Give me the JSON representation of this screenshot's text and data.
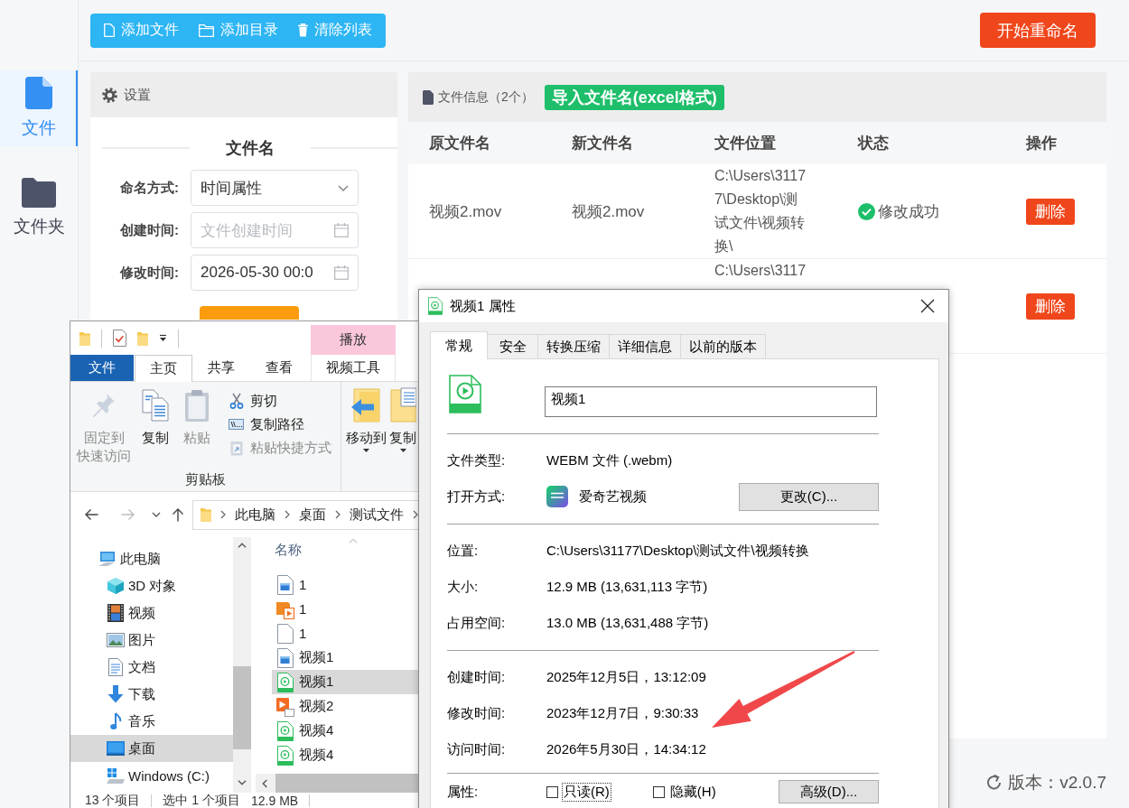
{
  "sidebar": {
    "items": [
      {
        "label": "文件",
        "selected": true
      },
      {
        "label": "文件夹",
        "selected": false
      }
    ]
  },
  "toolbar": {
    "buttons": [
      "添加文件",
      "添加目录",
      "清除列表"
    ],
    "start_button": "开始重命名"
  },
  "settings": {
    "title": "设置",
    "section": "文件名",
    "fields": [
      {
        "label": "命名方式:",
        "kind": "select",
        "value": "时间属性"
      },
      {
        "label": "创建时间:",
        "kind": "date",
        "placeholder": "文件创建时间"
      },
      {
        "label": "修改时间:",
        "kind": "date",
        "value": "2026-05-30 00:0"
      }
    ]
  },
  "file_panel": {
    "title": "文件信息（2个）",
    "import_button": "导入文件名(excel格式)",
    "columns": [
      "原文件名",
      "新文件名",
      "文件位置",
      "状态",
      "操作"
    ],
    "rows": [
      {
        "original": "视频2.mov",
        "new_name": "视频2.mov",
        "location": "C:\\Users\\31177\\Desktop\\测试文件\\视频转换\\",
        "status": "修改成功",
        "success": true,
        "action": "删除"
      },
      {
        "location": "C:\\Users\\3117",
        "action": "删除"
      }
    ]
  },
  "version": "版本：v2.0.7",
  "explorer": {
    "context_tab": "播放",
    "ribbon_tabs": [
      {
        "label": "文件",
        "kind": "backstage",
        "selected": false
      },
      {
        "label": "主页",
        "kind": "tab",
        "selected": true
      },
      {
        "label": "共享",
        "kind": "tab",
        "selected": false
      },
      {
        "label": "查看",
        "kind": "tab",
        "selected": false
      },
      {
        "label": "视频工具",
        "kind": "context",
        "selected": false
      }
    ],
    "clipboard": {
      "label": "剪贴板",
      "large": [
        {
          "lines": [
            "固定到",
            "快速访问"
          ],
          "disabled": true
        },
        {
          "lines": [
            "复制"
          ],
          "disabled": false
        },
        {
          "lines": [
            "粘贴"
          ],
          "disabled": true
        }
      ],
      "small": [
        {
          "label": "剪切",
          "disabled": false
        },
        {
          "label": "复制路径",
          "disabled": false
        },
        {
          "label": "粘贴快捷方式",
          "disabled": true
        }
      ]
    },
    "organize": [
      {
        "label": "移动到"
      },
      {
        "label": "复制"
      }
    ],
    "breadcrumb": [
      "此电脑",
      "桌面",
      "测试文件"
    ],
    "nav": [
      {
        "label": "此电脑",
        "selected": false,
        "children": [
          {
            "label": "3D 对象",
            "selected": false
          },
          {
            "label": "视频",
            "selected": false
          },
          {
            "label": "图片",
            "selected": false
          },
          {
            "label": "文档",
            "selected": false
          },
          {
            "label": "下载",
            "selected": false
          },
          {
            "label": "音乐",
            "selected": false
          },
          {
            "label": "桌面",
            "selected": true
          },
          {
            "label": "Windows (C:)",
            "selected": false
          }
        ]
      }
    ],
    "column": "名称",
    "files": [
      {
        "name": "1",
        "selected": false
      },
      {
        "name": "1",
        "selected": false
      },
      {
        "name": "1",
        "selected": false
      },
      {
        "name": "视频1",
        "selected": false
      },
      {
        "name": "视频1",
        "selected": true
      },
      {
        "name": "视频2",
        "selected": false
      },
      {
        "name": "视频4",
        "selected": false
      },
      {
        "name": "视频4",
        "selected": false
      }
    ],
    "status": [
      "13 个项目",
      "选中 1 个项目",
      "12.9 MB"
    ]
  },
  "properties": {
    "title": "视频1 属性",
    "tabs": [
      {
        "label": "常规",
        "selected": true
      },
      {
        "label": "安全",
        "selected": false
      },
      {
        "label": "转换压缩",
        "selected": false
      },
      {
        "label": "详细信息",
        "selected": false
      },
      {
        "label": "以前的版本",
        "selected": false
      }
    ],
    "name": "视频1",
    "groups": [
      [
        {
          "label": "文件类型:",
          "kind": "text",
          "value": "WEBM 文件 (.webm)"
        },
        {
          "label": "打开方式:",
          "kind": "app",
          "value": "爱奇艺视频",
          "button": "更改(C)..."
        }
      ],
      [
        {
          "label": "位置:",
          "kind": "text",
          "value": "C:\\Users\\31177\\Desktop\\测试文件\\视频转换"
        },
        {
          "label": "大小:",
          "kind": "text",
          "value": "12.9 MB (13,631,113 字节)"
        },
        {
          "label": "占用空间:",
          "kind": "text",
          "value": "13.0 MB (13,631,488 字节)"
        }
      ],
      [
        {
          "label": "创建时间:",
          "kind": "text",
          "value": "2025年12月5日，13:12:09"
        },
        {
          "label": "修改时间:",
          "kind": "text",
          "value": "2023年12月7日，9:30:33"
        },
        {
          "label": "访问时间:",
          "kind": "text",
          "value": "2026年5月30日，14:34:12"
        }
      ]
    ],
    "attributes": {
      "label": "属性:",
      "checkboxes": [
        {
          "label": "只读(R)",
          "checked": false,
          "focused": true
        },
        {
          "label": "隐藏(H)",
          "checked": false,
          "focused": false
        }
      ],
      "button": "高级(D)..."
    }
  }
}
